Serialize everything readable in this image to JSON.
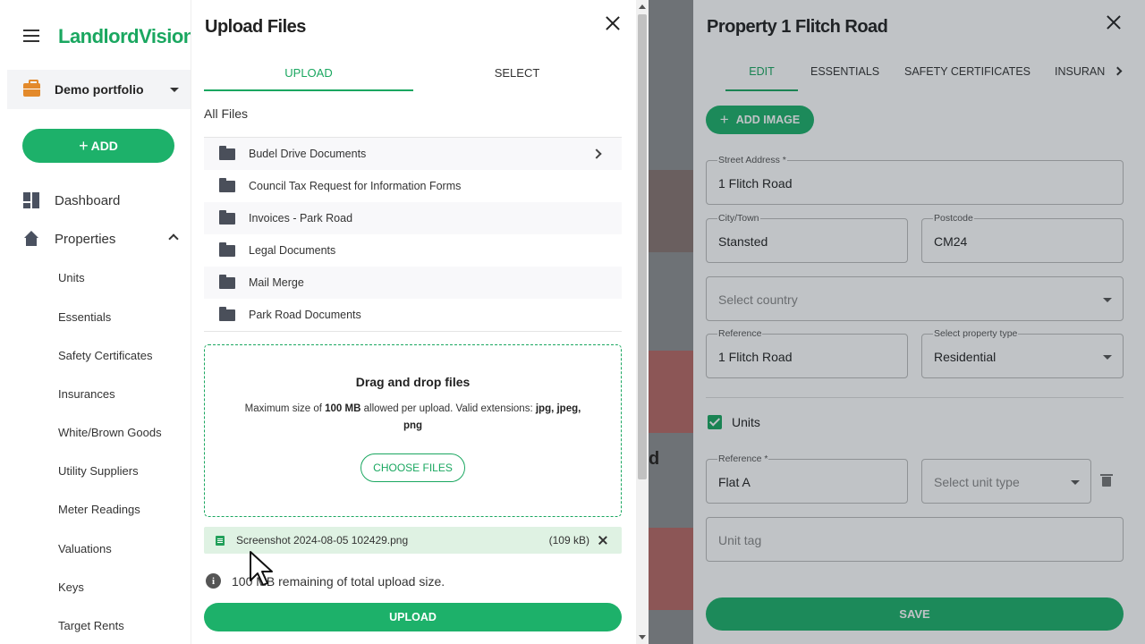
{
  "app": {
    "logo_text": "LandlordVision"
  },
  "sidebar": {
    "portfolio": "Demo portfolio",
    "add_label": "ADD",
    "nav": [
      {
        "label": "Dashboard",
        "icon": "dashboard-icon"
      },
      {
        "label": "Properties",
        "icon": "home-icon",
        "expanded": true
      }
    ],
    "subnav": [
      "Units",
      "Essentials",
      "Safety Certificates",
      "Insurances",
      "White/Brown Goods",
      "Utility Suppliers",
      "Meter Readings",
      "Valuations",
      "Keys",
      "Target Rents"
    ]
  },
  "upload_dialog": {
    "title": "Upload Files",
    "tabs": [
      {
        "label": "UPLOAD",
        "active": true
      },
      {
        "label": "SELECT",
        "active": false
      }
    ],
    "section_title": "All Files",
    "folders": [
      {
        "name": "Budel Drive Documents",
        "has_children": true
      },
      {
        "name": "Council Tax Request for Information Forms"
      },
      {
        "name": "Invoices - Park Road"
      },
      {
        "name": "Legal Documents"
      },
      {
        "name": "Mail Merge"
      },
      {
        "name": "Park Road Documents"
      }
    ],
    "dropzone": {
      "title": "Drag and drop files",
      "desc_prefix": "Maximum size of ",
      "max_size": "100 MB",
      "desc_middle": " allowed per upload. Valid extensions: ",
      "extensions": "jpg, jpeg, png",
      "choose_label": "CHOOSE FILES"
    },
    "selected_file": {
      "name": "Screenshot 2024-08-05 102429.png",
      "size": "(109 kB)"
    },
    "remaining_text": "100 MB remaining of total upload size.",
    "upload_label": "UPLOAD"
  },
  "background_page": {
    "partial_text": "d"
  },
  "property_panel": {
    "title": "Property 1 Flitch Road",
    "tabs": [
      {
        "label": "EDIT",
        "active": true
      },
      {
        "label": "ESSENTIALS"
      },
      {
        "label": "SAFETY CERTIFICATES"
      },
      {
        "label": "INSURAN"
      }
    ],
    "add_image_label": "ADD IMAGE",
    "fields": {
      "street_address": {
        "label": "Street Address *",
        "value": "1 Flitch Road"
      },
      "city": {
        "label": "City/Town",
        "value": "Stansted"
      },
      "postcode": {
        "label": "Postcode",
        "value": "CM24"
      },
      "country": {
        "placeholder": "Select country"
      },
      "reference": {
        "label": "Reference",
        "value": "1 Flitch Road"
      },
      "property_type": {
        "label": "Select property type",
        "value": "Residential"
      }
    },
    "units": {
      "label": "Units",
      "checked": true,
      "reference": {
        "label": "Reference *",
        "value": "Flat A"
      },
      "unit_type": {
        "placeholder": "Select unit type"
      },
      "unit_tag": {
        "placeholder": "Unit tag"
      }
    },
    "save_label": "SAVE"
  },
  "colors": {
    "accent": "#1db16a",
    "accent_dark": "#1aa760",
    "portfolio_icon": "#e38a2b"
  }
}
